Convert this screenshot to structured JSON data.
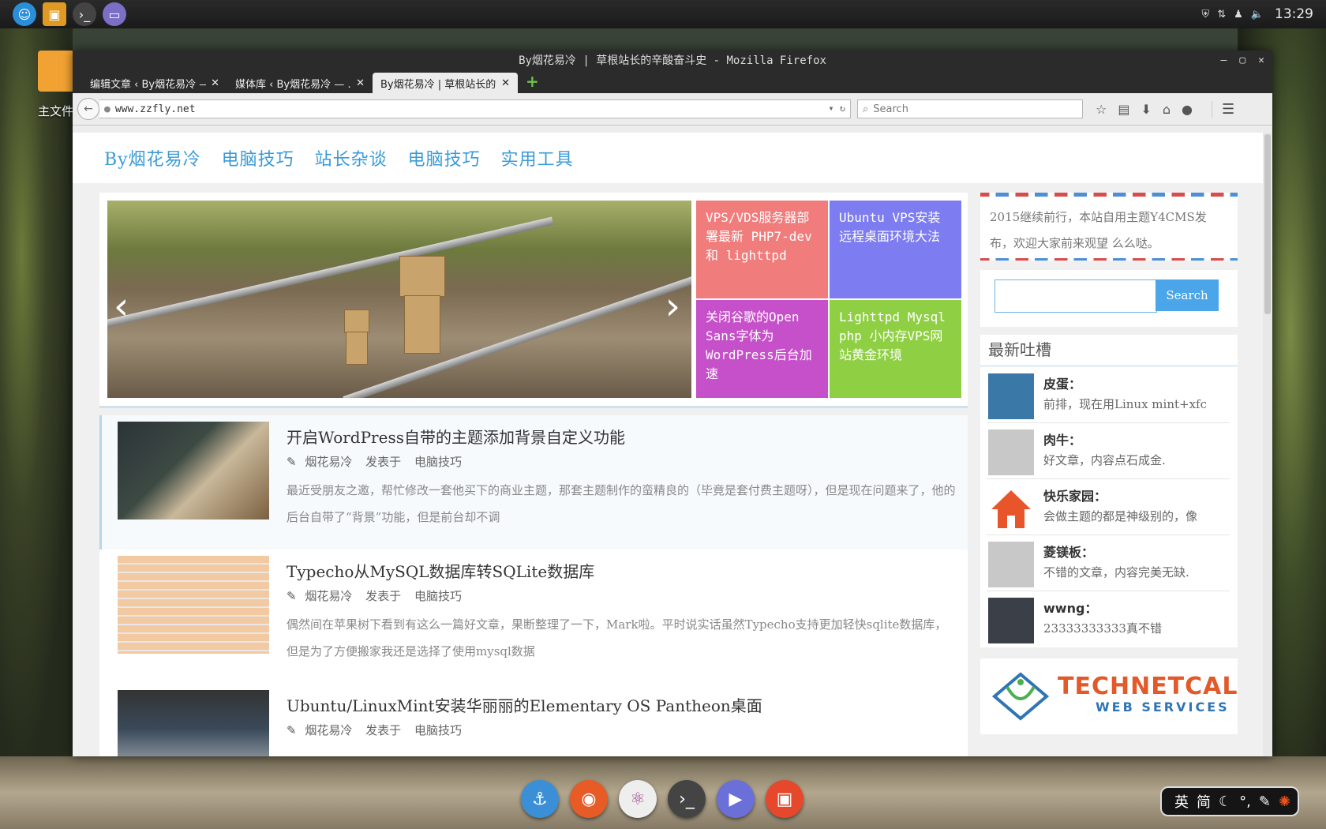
{
  "desktop": {
    "folder_label": "主文件",
    "clock": "13:29",
    "launchers": [
      "finder-icon",
      "file-manager-icon",
      "terminal-icon",
      "folder-icon"
    ],
    "dock": [
      {
        "name": "anchor-icon",
        "color": "#3b8fd6"
      },
      {
        "name": "firefox-icon",
        "color": "#e65b26"
      },
      {
        "name": "atom-icon",
        "color": "#eee"
      },
      {
        "name": "terminal-icon",
        "color": "#444444"
      },
      {
        "name": "video-player-icon",
        "color": "#6a70d8"
      },
      {
        "name": "archive-icon",
        "color": "#e6482c"
      }
    ],
    "ime": {
      "lang1": "英",
      "lang2": "简"
    }
  },
  "window": {
    "title": "By烟花易冷 | 草根站长的辛酸奋斗史 - Mozilla Firefox",
    "tabs": [
      {
        "label": "编辑文章 ‹ By烟花易冷 —",
        "active": false
      },
      {
        "label": "媒体库 ‹ By烟花易冷 — …",
        "active": false
      },
      {
        "label": "By烟花易冷 | 草根站长的…",
        "active": true
      }
    ],
    "url": "www.zzfly.net",
    "search_placeholder": "Search"
  },
  "site": {
    "nav": [
      "By烟花易冷",
      "电脑技巧",
      "站长杂谈",
      "电脑技巧",
      "实用工具"
    ],
    "tiles": [
      {
        "text": "VPS/VDS服务器部署最新 PHP7-dev 和 lighttpd",
        "color": "#f17c7c"
      },
      {
        "text": "Ubuntu VPS安装远程桌面环境大法",
        "color": "#7d7cf0"
      },
      {
        "text": "关闭谷歌的Open Sans字体为WordPress后台加速",
        "color": "#c650c9"
      },
      {
        "text": "Lighttpd Mysql php 小内存VPS网站黄金环境",
        "color": "#8fcf44"
      }
    ],
    "posts": [
      {
        "title": "开启WordPress自带的主题添加背景自定义功能",
        "author": "烟花易冷",
        "published": "发表于",
        "category": "电脑技巧",
        "excerpt": "最近受朋友之邀，帮忙修改一套他买下的商业主题，那套主题制作的蛮精良的（毕竟是套付费主题呀），但是现在问题来了，他的后台自带了“背景”功能，但是前台却不调"
      },
      {
        "title": "Typecho从MySQL数据库转SQLite数据库",
        "author": "烟花易冷",
        "published": "发表于",
        "category": "电脑技巧",
        "excerpt": "偶然间在苹果树下看到有这么一篇好文章，果断整理了一下，Mark啦。平时说实话虽然Typecho支持更加轻快sqlite数据库，但是为了方便搬家我还是选择了使用mysql数据"
      },
      {
        "title": "Ubuntu/LinuxMint安装华丽丽的Elementary OS Pantheon桌面",
        "author": "烟花易冷",
        "published": "发表于",
        "category": "电脑技巧",
        "excerpt": ""
      }
    ],
    "notice": "2015继续前行，本站自用主题Y4CMS发布，欢迎大家前来观望 么么哒。",
    "search_button": "Search",
    "comments_title": "最新吐槽",
    "comments": [
      {
        "name": "皮蛋：",
        "text": "前排，现在用Linux mint+xfc",
        "avatar_color": "#3a78a8"
      },
      {
        "name": "肉牛：",
        "text": "好文章，内容点石成金.",
        "avatar_color": "#c8c8c8"
      },
      {
        "name": "快乐家园：",
        "text": "会做主题的都是神级别的，像",
        "avatar_color": "#e8552a"
      },
      {
        "name": "菱镁板：",
        "text": "不错的文章，内容完美无缺.",
        "avatar_color": "#c8c8c8"
      },
      {
        "name": "wwng：",
        "text": "23333333333真不错",
        "avatar_color": "#3b3f48"
      }
    ],
    "ad": {
      "line1": "TECHNETCAL",
      "line2": "WEB SERVICES"
    }
  }
}
